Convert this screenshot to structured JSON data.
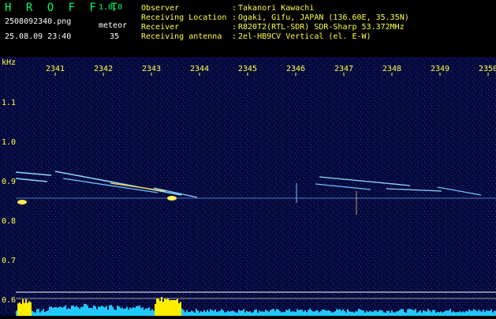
{
  "header": {
    "app_title": "H R O F F T",
    "app_version": "1.0.0",
    "file_name": "2508092340.png",
    "datetime": "25.08.09 23:40",
    "meteor_label": "meteor",
    "meteor_count": "35",
    "info": [
      {
        "label": "Observer",
        "value": "Takanori Kawachi"
      },
      {
        "label": "Receiving Location",
        "value": "Ogaki, Gifu, JAPAN (136.60E, 35.35N)"
      },
      {
        "label": "Receiver",
        "value": "R820T2(RTL-SDR) SDR-Sharp 53.372MHz"
      },
      {
        "label": "Receiving antenna",
        "value": "2el-HB9CV Vertical (el. E-W)"
      }
    ],
    "colon": ":"
  },
  "spectrogram": {
    "y_unit": "kHz",
    "time_ticks": [
      "2341",
      "2342",
      "2343",
      "2344",
      "2345",
      "2346",
      "2347",
      "2348",
      "2349",
      "2350"
    ],
    "freq_ticks": [
      "1.1",
      "1.0",
      "0.9",
      "0.8",
      "0.7",
      "0.6"
    ],
    "freq_values": [
      1.1,
      1.0,
      0.9,
      0.8,
      0.7,
      0.6
    ],
    "colors": {
      "background": "#05093a",
      "text_axis": "#ffff44",
      "text_header_left": "#00ff66",
      "trace": "#8fd6ff",
      "bars": "#22c8ff",
      "bars_hot": "#ffee00"
    }
  }
}
